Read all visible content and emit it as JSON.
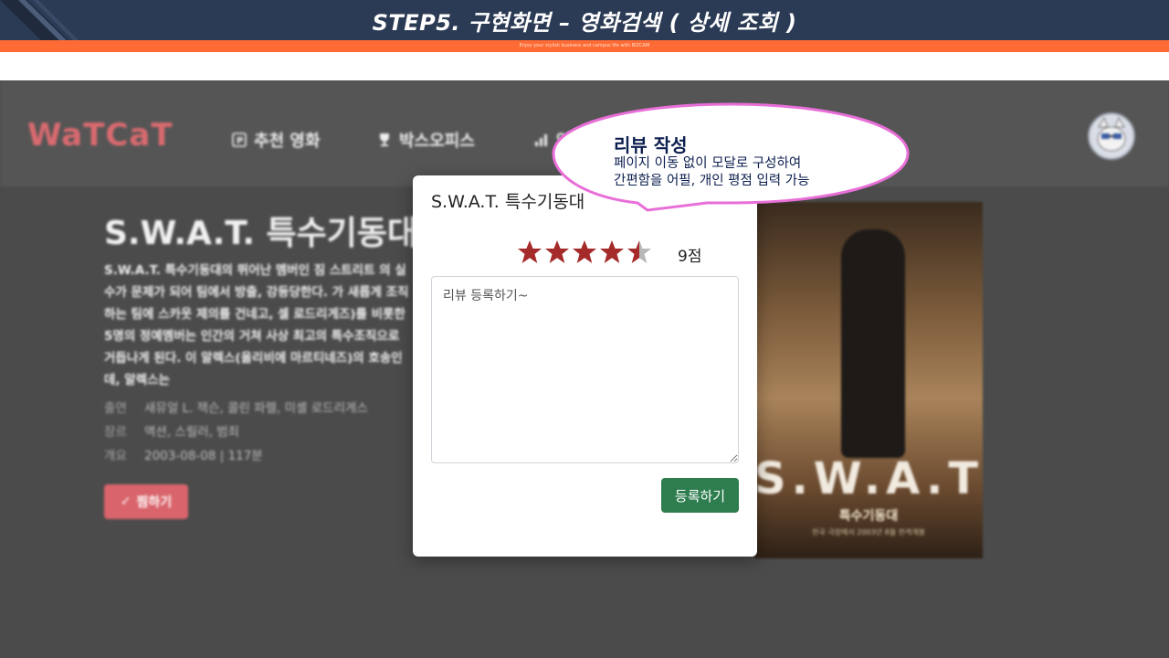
{
  "slide": {
    "title": "STEP5.  구현화면 – 영화검색 ( 상세 조회 )",
    "subtitle": "Enjoy your stylish business and campus life with BIZCAM",
    "colors": {
      "header": "#2c3b55",
      "accent": "#ff6b35"
    }
  },
  "app": {
    "logo": "WaTCaT",
    "nav": [
      {
        "label": "추천 영화",
        "icon": "recommend-icon"
      },
      {
        "label": "박스오피스",
        "icon": "trophy-icon"
      },
      {
        "label": "영",
        "icon": "chart-bar-icon"
      }
    ],
    "avatar_icon": "user-avatar-cat-icon"
  },
  "movie": {
    "title": "S.W.A.T. 특수기동대",
    "description": "S.W.A.T. 특수기동대의 뛰어난 멤버인 짐 스트리트 의 실수가 문제가 되어 팀에서 방출, 강등당한다. 가 새롭게 조직하는 팀에 스카웃 제의를 건네고, 셀 로드리게즈)를 비롯한 5명의 정예멤버는 인간의 거쳐 사상 최고의 특수조직으로 거듭나게 된다. 이 알렉스(올리비에 마르티네즈)의 호송인데, 알렉스는",
    "meta": [
      {
        "key": "출연",
        "value": "새뮤얼 L. 잭슨, 콜린 파렐, 미셸 로드리게스"
      },
      {
        "key": "장르",
        "value": "액션, 스릴러, 범죄"
      },
      {
        "key": "개요",
        "value": "2003-08-08 | 117분"
      }
    ],
    "like_label": "찜하기",
    "poster": {
      "title": "S.W.A.T",
      "subtitle": "특수기동대",
      "caption": "전국 극장에서 2003년 8월 전격개봉"
    }
  },
  "modal": {
    "title": "S.W.A.T. 특수기동대",
    "rating": 4.5,
    "rating_max": 5,
    "score_label": "9점",
    "textarea_value": "리뷰 등록하기~",
    "submit_label": "등록하기",
    "colors": {
      "star": "#a52a2a",
      "star_empty": "#b8b8b8",
      "button": "#2e7d4f"
    }
  },
  "callout": {
    "title": "리뷰 작성",
    "line1": "페이지 이동 없이 모달로 구성하여",
    "line2": "간편함을 어필, 개인 평점 입력 가능",
    "colors": {
      "border": "#e86fd8",
      "text": "#0d1f4f"
    }
  }
}
